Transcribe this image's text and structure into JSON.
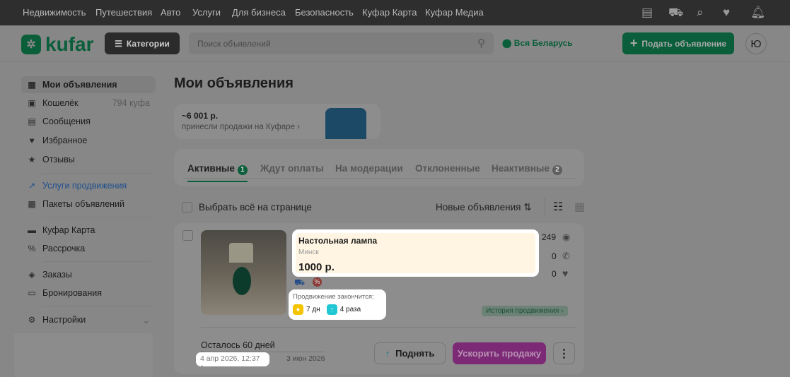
{
  "topnav": [
    "Недвижимость",
    "Путешествия",
    "Авто",
    "Услуги",
    "Для бизнеса",
    "Безопасность",
    "Куфар Карта",
    "Куфар Медиа"
  ],
  "header": {
    "logo": "kufar",
    "categories": "Категории",
    "search_placeholder": "Поиск объявлений",
    "location": "Вся Беларусь",
    "post": "Подать объявление",
    "avatar": "Ю"
  },
  "sidebar": [
    {
      "label": "Мои объявления",
      "icon": "grid-icon"
    },
    {
      "label": "Кошелёк",
      "count": "794 куфа",
      "icon": "wallet-icon"
    },
    {
      "label": "Сообщения",
      "icon": "message-icon"
    },
    {
      "label": "Избранное",
      "icon": "heart-icon"
    },
    {
      "label": "Отзывы",
      "icon": "star-icon"
    },
    {
      "label": "Услуги продвижения",
      "icon": "trend-icon"
    },
    {
      "label": "Пакеты объявлений",
      "icon": "package-icon"
    },
    {
      "label": "Куфар Карта",
      "icon": "card-icon"
    },
    {
      "label": "Рассрочка",
      "icon": "percent-icon"
    },
    {
      "label": "Заказы",
      "icon": "box-icon"
    },
    {
      "label": "Бронирования",
      "icon": "bed-icon"
    },
    {
      "label": "Настройки",
      "icon": "gear-icon"
    }
  ],
  "main": {
    "title": "Мои объявления",
    "promo": {
      "amount": "~6 001 р.",
      "text": "принесли продажи на Куфаре ›"
    },
    "tabs": [
      {
        "label": "Активные",
        "count": "1"
      },
      {
        "label": "Ждут оплаты"
      },
      {
        "label": "На модерации"
      },
      {
        "label": "Отклоненные"
      },
      {
        "label": "Неактивные",
        "count": "2"
      }
    ],
    "select_all": "Выбрать всё на странице",
    "sort": "Новые объявления ⇅",
    "listing": {
      "title": "Настольная лампа",
      "city": "Минск",
      "price": "1000 р.",
      "views": "249",
      "calls": "0",
      "favorites": "0",
      "promo_label": "Продвижение закончится:",
      "promo_days": "7 дн",
      "promo_ups": "4 раза",
      "history": "История продвижения ›",
      "remaining": "Осталось 60 дней",
      "remaining_fraction": 0.0,
      "start": "4 апр 2026, 12:37",
      "end": "3 июн 2026",
      "raise": "Поднять",
      "boost": "Ускорить продажу"
    }
  }
}
